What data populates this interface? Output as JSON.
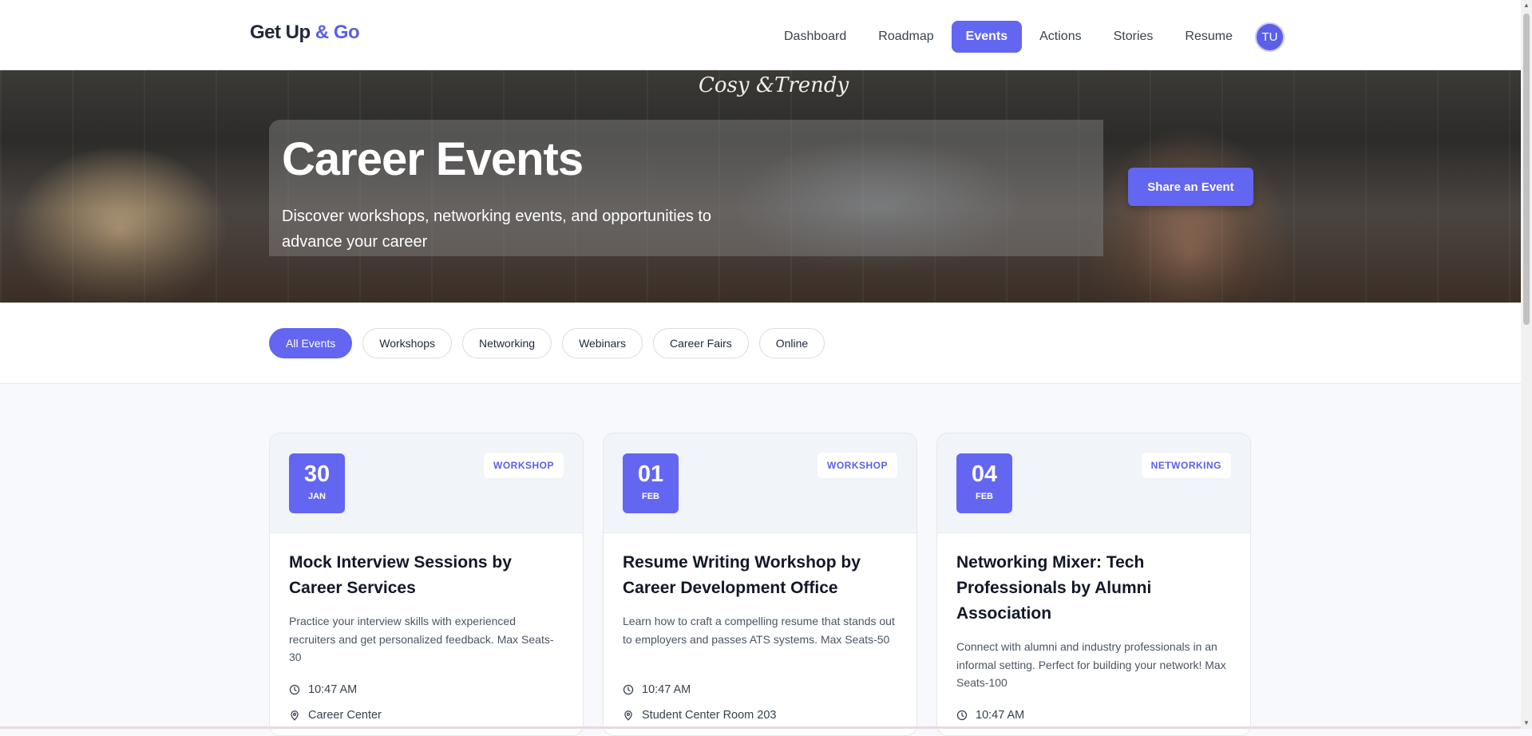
{
  "brand": {
    "part1": "Get Up",
    "part2": "& Go"
  },
  "nav": {
    "items": [
      "Dashboard",
      "Roadmap",
      "Events",
      "Actions",
      "Stories",
      "Resume"
    ],
    "active": "Events",
    "avatar_initials": "TU"
  },
  "hero": {
    "title": "Career Events",
    "subtitle": "Discover workshops, networking events, and opportunities to advance your career",
    "share_button": "Share an Event",
    "image_sign": "Cosy &Trendy"
  },
  "filters": {
    "chips": [
      "All Events",
      "Workshops",
      "Networking",
      "Webinars",
      "Career Fairs",
      "Online"
    ],
    "active": "All Events"
  },
  "events": [
    {
      "day": "30",
      "month": "JAN",
      "type": "WORKSHOP",
      "title": "Mock Interview Sessions by Career Services",
      "description": "Practice your interview skills with experienced recruiters and get personalized feedback. Max Seats-30",
      "time": "10:47 AM",
      "location": "Career Center"
    },
    {
      "day": "01",
      "month": "FEB",
      "type": "WORKSHOP",
      "title": "Resume Writing Workshop by Career Development Office",
      "description": "Learn how to craft a compelling resume that stands out to employers and passes ATS systems. Max Seats-50",
      "time": "10:47 AM",
      "location": "Student Center Room 203"
    },
    {
      "day": "04",
      "month": "FEB",
      "type": "NETWORKING",
      "title": "Networking Mixer: Tech Professionals by Alumni Association",
      "description": "Connect with alumni and industry professionals in an informal setting. Perfect for building your network! Max Seats-100",
      "time": "10:47 AM",
      "location": ""
    }
  ],
  "colors": {
    "accent": "#6366f1",
    "accent_text": "#5b5fe8"
  },
  "icons": {
    "time": "clock-icon",
    "location": "map-pin-icon"
  }
}
